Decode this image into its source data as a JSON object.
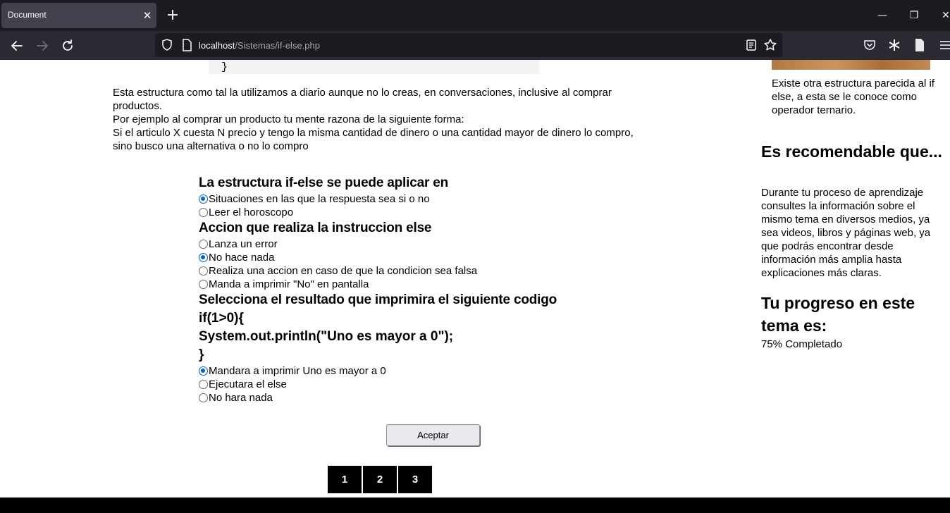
{
  "browser": {
    "tab_title": "Document",
    "tab_close": "✕",
    "new_tab": "+",
    "url_host": "localhost",
    "url_path": "/Sistemas/if-else.php",
    "window_minimize": "—",
    "window_restore": "❐",
    "window_close": "✕"
  },
  "code_block": {
    "closing_brace": "}"
  },
  "intro": {
    "line1": "Esta estructura como tal la utilizamos a diario aunque no lo creas, en conversaciones, inclusive al comprar productos.",
    "line2": "Por ejemplo al comprar un producto tu mente razona de la siguiente forma:",
    "line3": "Si el articulo X cuesta N precio y tengo la misma cantidad de dinero o una cantidad mayor de dinero lo compro, sino busco una alternativa o no lo compro"
  },
  "quiz": {
    "q1": {
      "title": "La estructura if-else se puede aplicar en",
      "options": [
        "Situaciones en las que la respuesta sea si o no",
        "Leer el horoscopo"
      ],
      "selected": 0
    },
    "q2": {
      "title": "Accion que realiza la instruccion else",
      "options": [
        "Lanza un error",
        "No hace nada",
        "Realiza una accion en caso de que la condicion sea falsa",
        "Manda a imprimir \"No\" en pantalla"
      ],
      "selected": 1
    },
    "q3": {
      "title": "Selecciona el resultado que imprimira el siguiente codigo",
      "code": [
        "if(1>0){",
        "System.out.println(\"Uno es mayor a 0\");",
        "}"
      ],
      "options": [
        "Mandara a imprimir Uno es mayor a 0",
        "Ejecutara el else",
        "No hara nada"
      ],
      "selected": 0
    },
    "submit_label": "Aceptar"
  },
  "pagination": [
    "1",
    "2",
    "3"
  ],
  "sidebar": {
    "note": "Existe otra estructura parecida al if else, a esta se le conoce como operador ternario.",
    "recommend_title": "Es recomendable que...",
    "recommend_text": "Durante tu proceso de aprendizaje consultes la información sobre el mismo tema en diversos medios, ya sea videos, libros y páginas web, ya que podrás encontrar desde información más amplia hasta explicaciones más claras.",
    "progress_title": "Tu progreso en este tema es:",
    "progress_text": "75% Completado",
    "progress_value": 0.75
  }
}
